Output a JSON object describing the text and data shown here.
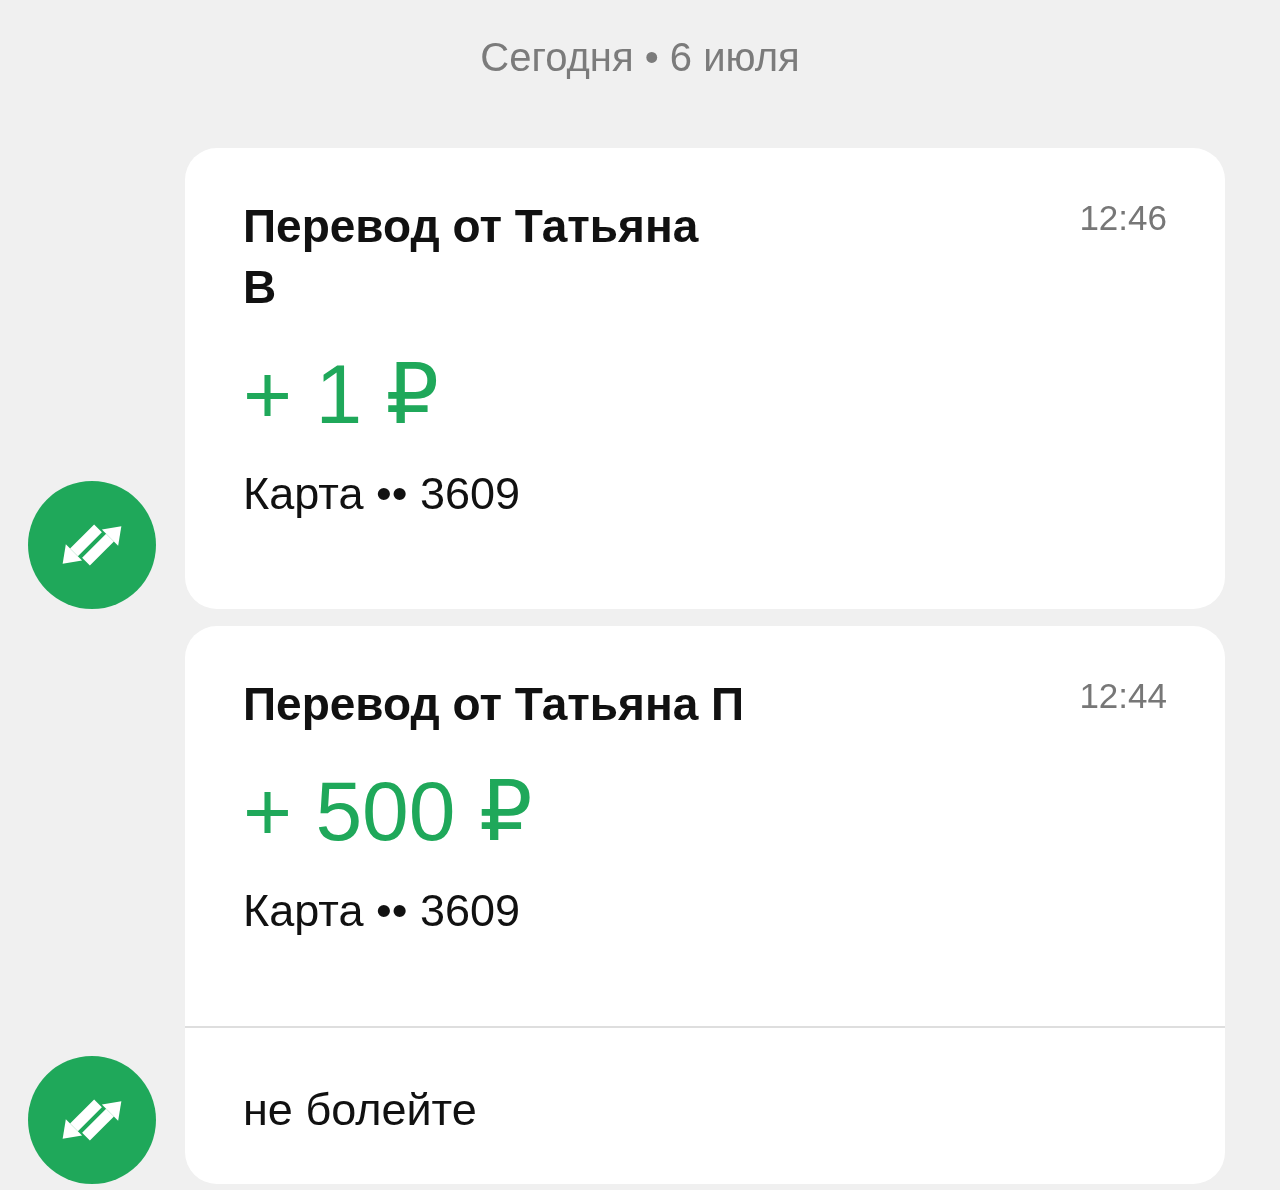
{
  "date_header": "Сегодня • 6 июля",
  "transfers": [
    {
      "title_lines": [
        "Перевод от Татьяна",
        "В"
      ],
      "time": "12:46",
      "amount": "+ 1 ₽",
      "account": "Карта •• 3609"
    },
    {
      "title_lines": [
        "Перевод от Татьяна П"
      ],
      "time": "12:44",
      "amount": "+ 500 ₽",
      "account": "Карта •• 3609",
      "message": "не болейте"
    }
  ]
}
